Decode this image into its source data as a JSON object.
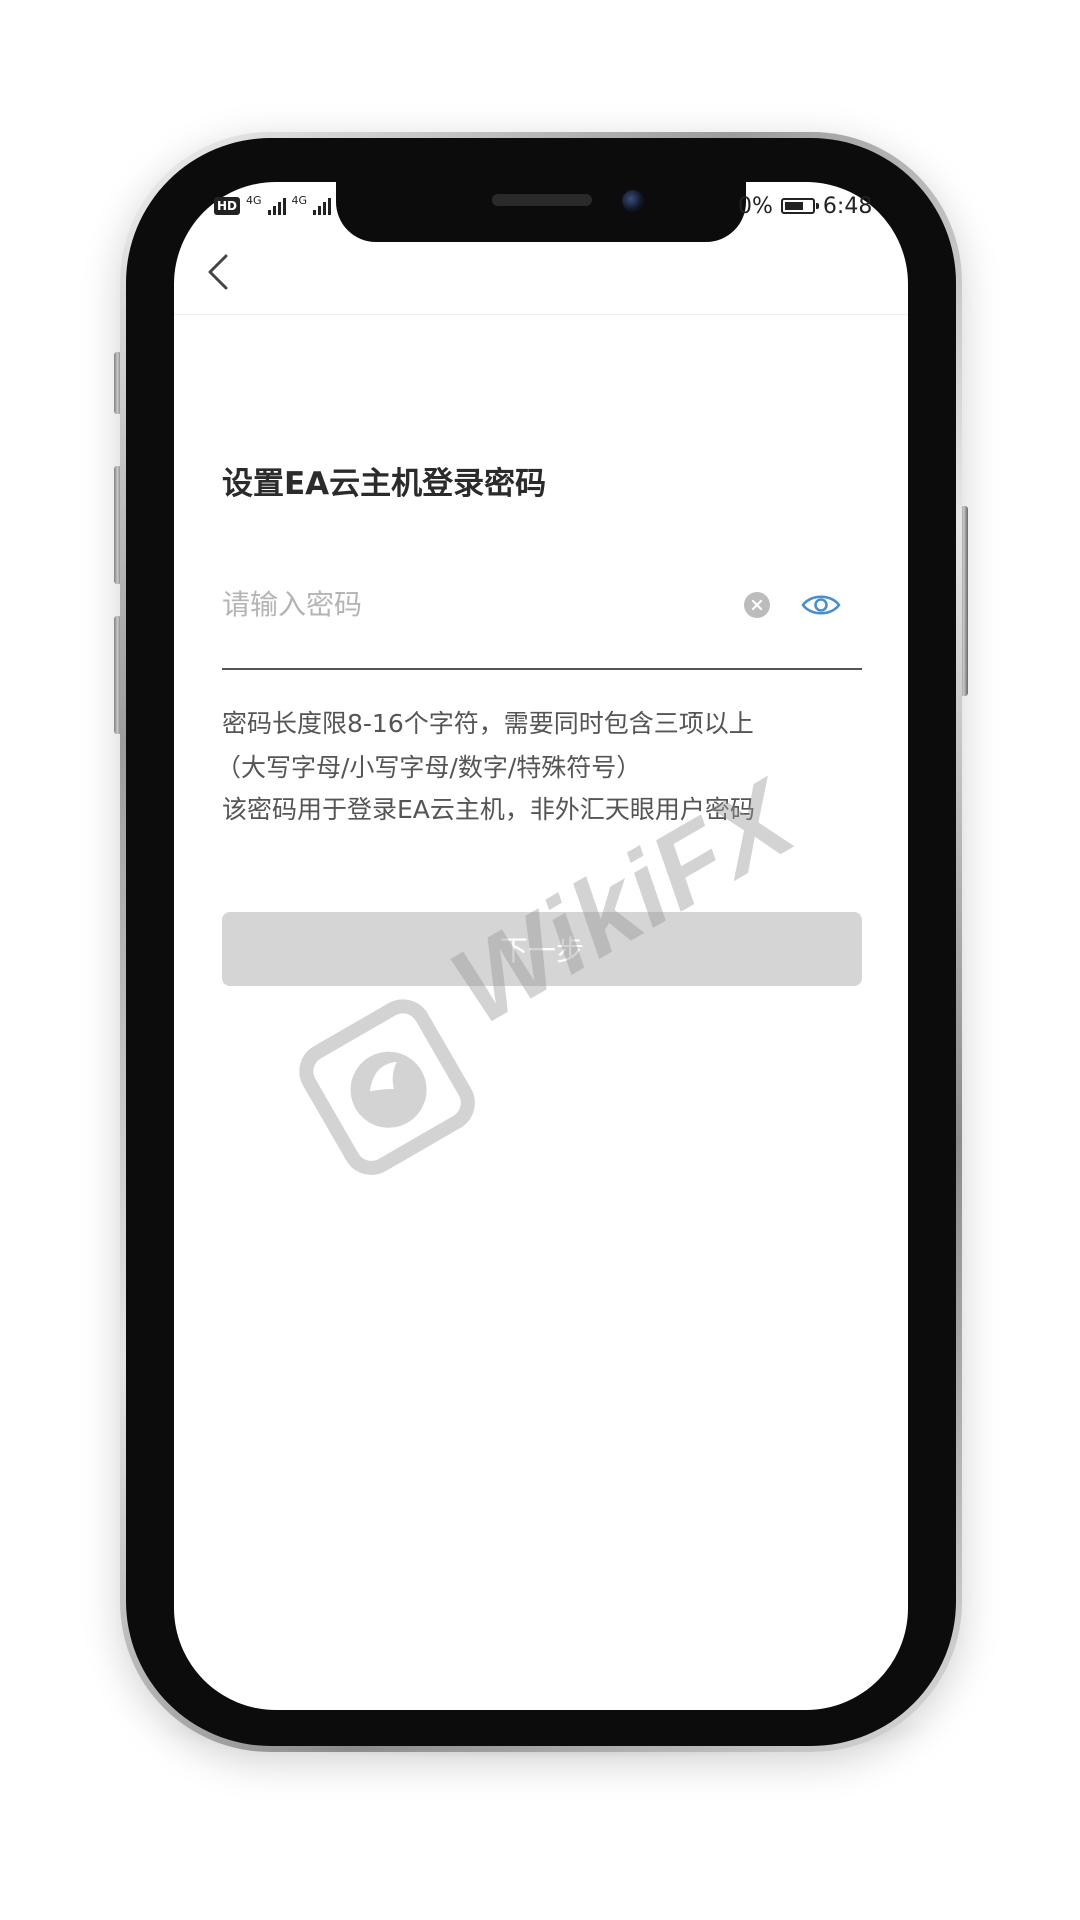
{
  "status_bar": {
    "hd": "HD",
    "net1": "4G",
    "net2": "4G",
    "battery_pct": "0%",
    "time": "6:48"
  },
  "page": {
    "title": "设置EA云主机登录密码",
    "password_placeholder": "请输入密码",
    "hint_line1": "密码长度限8-16个字符，需要同时包含三项以上",
    "hint_line2": "（大写字母/小写字母/数字/特殊符号）",
    "hint_line3": "该密码用于登录EA云主机，非外汇天眼用户密码",
    "next_label": "下一步"
  },
  "watermark": {
    "text": "WikiFX"
  },
  "colors": {
    "eye_icon": "#4a8fc7",
    "next_button_disabled": "#d5d5d5",
    "title": "#2b2b2b"
  },
  "icons": {
    "back": "chevron-left-icon",
    "clear": "clear-circle-icon",
    "visibility": "eye-icon"
  }
}
